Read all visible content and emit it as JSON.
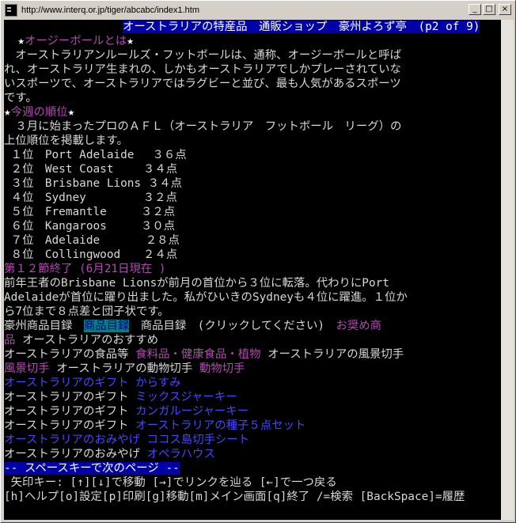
{
  "window": {
    "title": "http://www.interq.or.jp/tiger/abcabc/index1.htm",
    "minimize": "_",
    "maximize": "□",
    "close": "×"
  },
  "header": {
    "text": "オーストラリアの特産品　通販ショップ　豪州よろず亭　(p2 of 9)"
  },
  "section1": {
    "star_left": "★",
    "title": "オージーボールとは",
    "star_right": "★",
    "lines": [
      "　オーストラリアンルールズ・フットボールは、通称、オージーボールと呼ば",
      "れ、オーストラリア生まれの、しかもオーストラリアでしかプレーされていな",
      "いスポーツで、オーストラリアではラグビーと並び、最も人気があるスポーツ",
      "です。"
    ]
  },
  "section2": {
    "star_left": "★",
    "title": "今週の順位",
    "star_right": "★",
    "intro": [
      "　３月に始まったプロのＡＦＬ（オーストラリア　フットボール　リーグ）の",
      "上位順位を掲載します。"
    ],
    "rankings": [
      "１位　Port Adelaide　 ３６点",
      "２位　West Coast　　 ３４点",
      "３位　Brisbane Lions ３４点",
      "４位　Sydney　　　　　３２点",
      "５位　Fremantle　　　３２点",
      "６位　Kangaroos　　　３０点",
      "７位　Adelaide　　　　２８点",
      "８位　Collingwood　　２４点"
    ],
    "round_note": "第１２節終了 (6月21日現在 )",
    "summary": [
      "前年王者のBrisbane Lionsが前月の首位から３位に転落。代わりにPort",
      "Adelaideが首位に躍り出ました。私がひいきのSydneyも４位に躍進。１位か",
      "ら7位まで８点差と団子状です。"
    ]
  },
  "catalog": {
    "label1": "豪州商品目録　",
    "link_highlighted": "商品目録",
    "label2": "　商品目録　(クリックしてください)　",
    "link_recommended_1": "お奨め商",
    "link_recommended_2": "品",
    "label_recommend": " オーストラリアのおすすめ",
    "label_food": "オーストラリアの食品等 ",
    "link_food": "食料品・健康食品・植物",
    "label_scenery": " オーストラリアの風景切手",
    "link_scenery": "風景切手",
    "label_animal": " オーストラリアの動物切手 ",
    "link_animal": "動物切手",
    "link_gift_karasumi": "オーストラリアのギフト からすみ",
    "label_gift_1": "オーストラリアのギフト ",
    "link_mixed_jerky": "ミックスジャーキー",
    "label_gift_2": "オーストラリアのギフト ",
    "link_kangaroo_jerky": "カンガルージャーキー",
    "label_gift_3": "オーストラリアのギフト ",
    "link_seeds": "オーストラリアの種子５点セット",
    "link_cocos": "オーストラリアのおみやげ ココス島切手シート",
    "label_souvenir": "オーストラリアのおみやげ ",
    "link_opera": "オペラハウス"
  },
  "status": {
    "next_page": "-- スペースキーで次のページ --",
    "help_line1": " 矢印キー: [↑][↓]で移動 [→]でリンクを辿る [←]で一つ戻る",
    "help_line2": "[h]ヘルプ[o]設定[p]印刷[g]移動[m]メイン画面[q]終了 /=検索 [BackSpace]=履歴"
  },
  "colors": {
    "background": "#000000",
    "text": "#d8d8d8",
    "header_bg": "#0000a8",
    "link_magenta": "#b04ab0",
    "link_blue": "#4646ff",
    "highlight_bg": "#008080"
  }
}
